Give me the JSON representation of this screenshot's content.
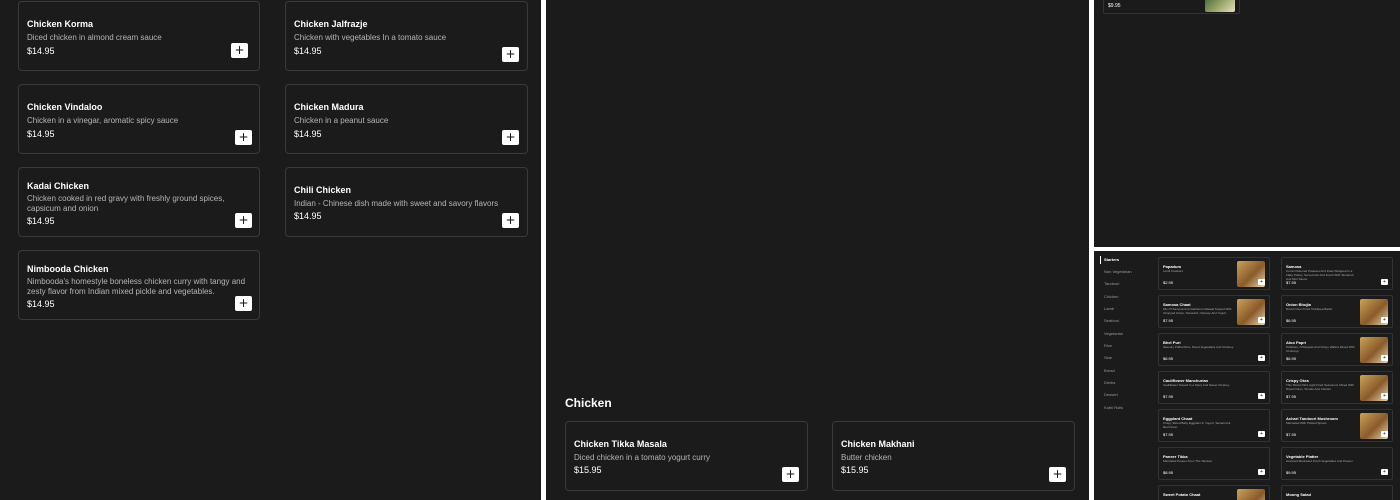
{
  "panel1": {
    "cards": [
      {
        "name": "Chicken Korma",
        "desc": "Diced chicken in almond cream sauce",
        "price": "$14.95"
      },
      {
        "name": "Chicken Jalfrazje",
        "desc": "Chicken with vegetables In a tomato sauce",
        "price": "$14.95"
      },
      {
        "name": "Chicken Vindaloo",
        "desc": "Chicken in a vinegar, aromatic spicy sauce",
        "price": "$14.95"
      },
      {
        "name": "Chicken Madura",
        "desc": "Chicken in a peanut sauce",
        "price": "$14.95"
      },
      {
        "name": "Kadai Chicken",
        "desc": "Chicken cooked in red gravy with freshly ground spices, capsicum and onion",
        "price": "$14.95"
      },
      {
        "name": "Chili Chicken",
        "desc": "Indian - Chinese dish made with sweet and savory flavors",
        "price": "$14.95"
      },
      {
        "name": "Nimbooda Chicken",
        "desc": "Nimbooda's homestyle boneless chicken curry with tangy and zesty flavor from Indian mixed pickle and vegetables.",
        "price": "$14.95"
      }
    ],
    "add_label": "+"
  },
  "panel2": {
    "section_title": "Chicken",
    "cards": [
      {
        "name": "Chicken Tikka Masala",
        "desc": "Diced chicken in a tomato yogurt curry",
        "price": "$15.95"
      },
      {
        "name": "Chicken Makhani",
        "desc": "Butter chicken",
        "price": "$15.95"
      }
    ]
  },
  "panel3": {
    "price": "$9.95"
  },
  "panel4": {
    "sidebar": [
      "Starters",
      "Non Vegetarian",
      "Tandoori",
      "Chicken",
      "Lamb",
      "Seafood",
      "Vegetarian",
      "Rice",
      "Side",
      "Bread",
      "Drinks",
      "Dessert",
      "Kathi Rolls"
    ],
    "cards": [
      {
        "name": "Papadum",
        "desc": "Lentil Crackers",
        "price": "$2.95",
        "img": true
      },
      {
        "name": "Samosa",
        "desc": "Cumin Flavored Potatoes And Peas Wrapped In a Flaky Pastry, Served Hot And Fresh With Tamarind And Mint Sauce.",
        "price": "$7.95",
        "img": false
      },
      {
        "name": "Samosa Chaat",
        "desc": "Mix Of Samosa And Garbanzo Masala Topped With Chopped Onion, Tamarind, Chutney And Yogurt",
        "price": "$7.95",
        "img": true
      },
      {
        "name": "Onion Bhujia",
        "desc": "Diced Onion Fried Chickpea Batter",
        "price": "$6.95",
        "img": true
      },
      {
        "name": "Bhel Puri",
        "desc": "Savoury Puffed Rice, Diced Vegetables And Chutney",
        "price": "$6.95",
        "img": false
      },
      {
        "name": "Aloo Papri",
        "desc": "Potatoes, Chickpeas And Crispy Wafers Mixed With Chutneys",
        "price": "$6.95",
        "img": true
      },
      {
        "name": "Cauliflower Manchurian",
        "desc": "Cauliflower Tossed In a Spicy And Sweet Chutney",
        "price": "$7.95",
        "img": false
      },
      {
        "name": "Crispy Okra",
        "desc": "Thin Sliced Okra Light Fried Seasoned, Mixed With Diced Onion, Tomato And Cilantro",
        "price": "$7.95",
        "img": true
      },
      {
        "name": "Eggplant Chaat",
        "desc": "Crispy Sliced Baby Eggplant In Yogurt, Tamarind & Red Onion",
        "price": "$7.95",
        "img": false
      },
      {
        "name": "Achari Tandoori Mushroom",
        "desc": "Marinated With Pickled Spices",
        "price": "$7.95",
        "img": true
      },
      {
        "name": "Paneer Tikka",
        "desc": "Marinated Paneer From The Tandoor",
        "price": "$8.95",
        "img": false
      },
      {
        "name": "Vegetable Platter",
        "desc": "Assorted Marinated Fresh Vegetables And Paneer",
        "price": "$9.95",
        "img": false
      },
      {
        "name": "Sweet Potato Chaat",
        "desc": "",
        "price": "",
        "img": true
      },
      {
        "name": "Moong Salad",
        "desc": "",
        "price": "",
        "img": false
      }
    ]
  }
}
